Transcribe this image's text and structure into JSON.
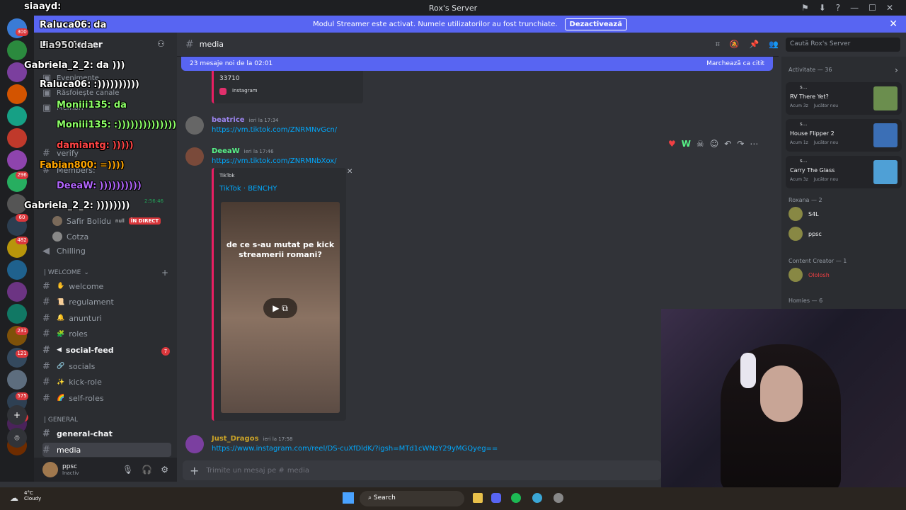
{
  "window": {
    "title": "Rox's Server"
  },
  "banner": {
    "text": "Modul Streamer este activat. Numele utilizatorilor au fost trunchiate.",
    "button": "Dezactivează"
  },
  "guild_badges": [
    "300",
    "296",
    "60",
    "482",
    "231",
    "121",
    "575",
    "2"
  ],
  "server": {
    "name": "Rox's Server"
  },
  "sidebar_top": [
    "Evenimente",
    "Răsfoiește canale",
    "Membri"
  ],
  "voice_channel": {
    "users": [
      {
        "name": "Safir Bolidu",
        "tag": "null",
        "badge": "ÎN DIRECT"
      },
      {
        "name": "Cotza"
      }
    ],
    "time": "2:56:46"
  },
  "channels_misc": [
    {
      "label": "verify"
    },
    {
      "label": "Members: "
    },
    {
      "label": "Chilling"
    }
  ],
  "welcome_category": "| WELCOME",
  "welcome_channels": [
    "welcome",
    "regulament",
    "anunturi",
    "roles",
    "social-feed",
    "socials",
    "kick-role",
    "self-roles"
  ],
  "social_feed_badge": "7",
  "general_category": "| GENERAL",
  "general_channels": [
    "general-chat",
    "media"
  ],
  "user": {
    "name": "ppsc",
    "status": "Inactiv"
  },
  "chat": {
    "channel": "media",
    "new_messages": "23 mesaje noi de la 02:01",
    "mark_read": "Marchează ca citit",
    "input_placeholder": "Trimite un mesaj pe #",
    "input_channel": "media"
  },
  "prev_embed": {
    "count": "33710",
    "source": "Instagram"
  },
  "messages": [
    {
      "author": "beatrice",
      "time": "ieri la 17:34",
      "link": "https://vm.tiktok.com/ZNRMNvGcn/",
      "color": "#9b84ee"
    },
    {
      "author": "DeeaW",
      "time": "ieri la 17:46",
      "link": "https://vm.tiktok.com/ZNRMNbXox/",
      "color": "#57f287"
    },
    {
      "author": "Just_Dragos",
      "time": "ieri la 17:58",
      "link": "https://www.instagram.com/reel/DS-cuXfDldK/?igsh=MTd1cWNzY29yMGQyeg==",
      "color": "#c9a227"
    }
  ],
  "embed": {
    "provider": "TikTok",
    "title": "TikTok · BENCHY",
    "caption": "de ce s-au mutat pe kick streamerii romani?"
  },
  "search_placeholder": "Caută Rox's Server",
  "activity": {
    "header": "Activitate — 36",
    "items": [
      {
        "user": "s...",
        "title": "RV There Yet?",
        "meta": "Acum 3z",
        "tag": "Jucător nou",
        "thumb": "#6b8e4e"
      },
      {
        "user": "s...",
        "title": "House Flipper 2",
        "meta": "Acum 1z",
        "tag": "Jucător nou",
        "thumb": "#3b6fb6"
      },
      {
        "user": "s...",
        "title": "Carry The Glass",
        "meta": "Acum 3z",
        "tag": "Jucător nou",
        "thumb": "#4fa0d6"
      }
    ]
  },
  "member_groups": [
    {
      "label": "Roxana — 2",
      "members": [
        "S4L",
        "ppsc"
      ]
    },
    {
      "label": "Content Creator — 1",
      "members": [
        "Ololosh"
      ]
    },
    {
      "label": "Homies — 6"
    }
  ],
  "overlay_chat": [
    {
      "name": "siaayd:",
      "text": "",
      "color": "#ffffff"
    },
    {
      "name": "Raluca06:",
      "text": "da",
      "color": "#ffffff"
    },
    {
      "name": "Lia950:",
      "text": "da",
      "color": "#d4d4d4"
    },
    {
      "name": "Gabriela_2_2:",
      "text": "da )))",
      "color": "#ffffff"
    },
    {
      "name": "Raluca06:",
      "text": ":))))))))))",
      "color": "#ffffff"
    },
    {
      "name": "Moniii135:",
      "text": "da",
      "color": "#8cff66"
    },
    {
      "name": "Moniii135:",
      "text": ":))))))))))))))",
      "color": "#8cff66"
    },
    {
      "name": "damiantg:",
      "text": ")))))",
      "color": "#ff4444"
    },
    {
      "name": "Fabian800:",
      "text": "=))))",
      "color": "#ffa500"
    },
    {
      "name": "DeeaW:",
      "text": "))))))))))",
      "color": "#b366ff"
    },
    {
      "name": "Gabriela_2_2:",
      "text": "))))))))",
      "color": "#ffffff"
    }
  ],
  "taskbar": {
    "weather_temp": "4°C",
    "weather_text": "Cloudy",
    "search": "Search"
  }
}
